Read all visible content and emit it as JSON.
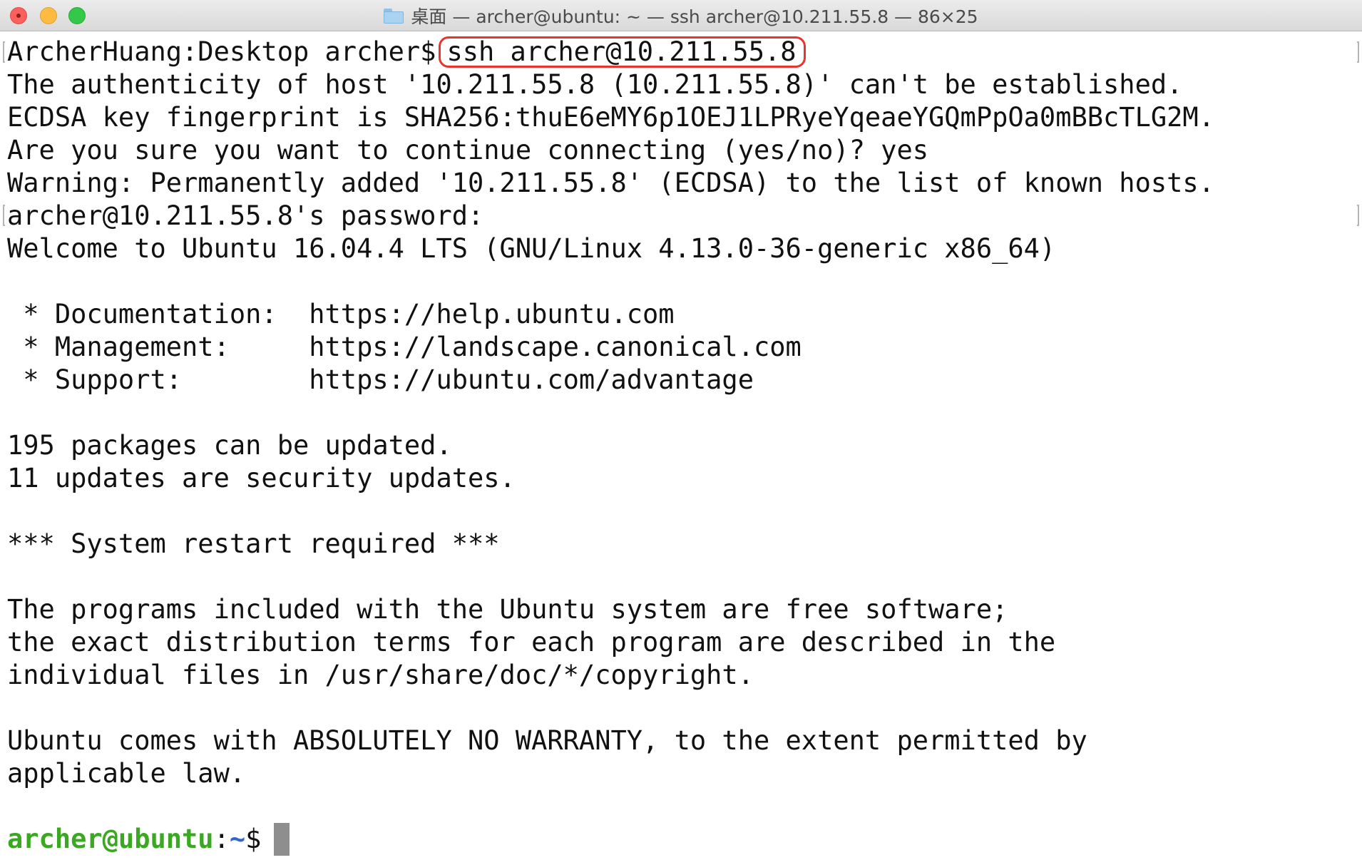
{
  "window": {
    "title": "桌面 — archer@ubuntu: ~ — ssh archer@10.211.55.8 — 86×25",
    "folder_icon": "folder-icon"
  },
  "terminal": {
    "first_prompt": "ArcherHuang:Desktop archer$",
    "first_command": "ssh archer@10.211.55.8",
    "lines": [
      "The authenticity of host '10.211.55.8 (10.211.55.8)' can't be established.",
      "ECDSA key fingerprint is SHA256:thuE6eMY6p1OEJ1LPRyeYqeaeYGQmPpOa0mBBcTLG2M.",
      "Are you sure you want to continue connecting (yes/no)? yes",
      "Warning: Permanently added '10.211.55.8' (ECDSA) to the list of known hosts.",
      "archer@10.211.55.8's password:",
      "Welcome to Ubuntu 16.04.4 LTS (GNU/Linux 4.13.0-36-generic x86_64)",
      "",
      " * Documentation:  https://help.ubuntu.com",
      " * Management:     https://landscape.canonical.com",
      " * Support:        https://ubuntu.com/advantage",
      "",
      "195 packages can be updated.",
      "11 updates are security updates.",
      "",
      "*** System restart required ***",
      "",
      "The programs included with the Ubuntu system are free software;",
      "the exact distribution terms for each program are described in the",
      "individual files in /usr/share/doc/*/copyright.",
      "",
      "Ubuntu comes with ABSOLUTELY NO WARRANTY, to the extent permitted by",
      "applicable law.",
      ""
    ],
    "final_prompt": {
      "user_host": "archer@ubuntu",
      "colon": ":",
      "path": "~",
      "dollar": "$"
    }
  },
  "colors": {
    "highlight_border": "#e8342c",
    "prompt_user": "#3aa820",
    "prompt_path": "#3466c8",
    "cursor": "#8e8e8e"
  }
}
